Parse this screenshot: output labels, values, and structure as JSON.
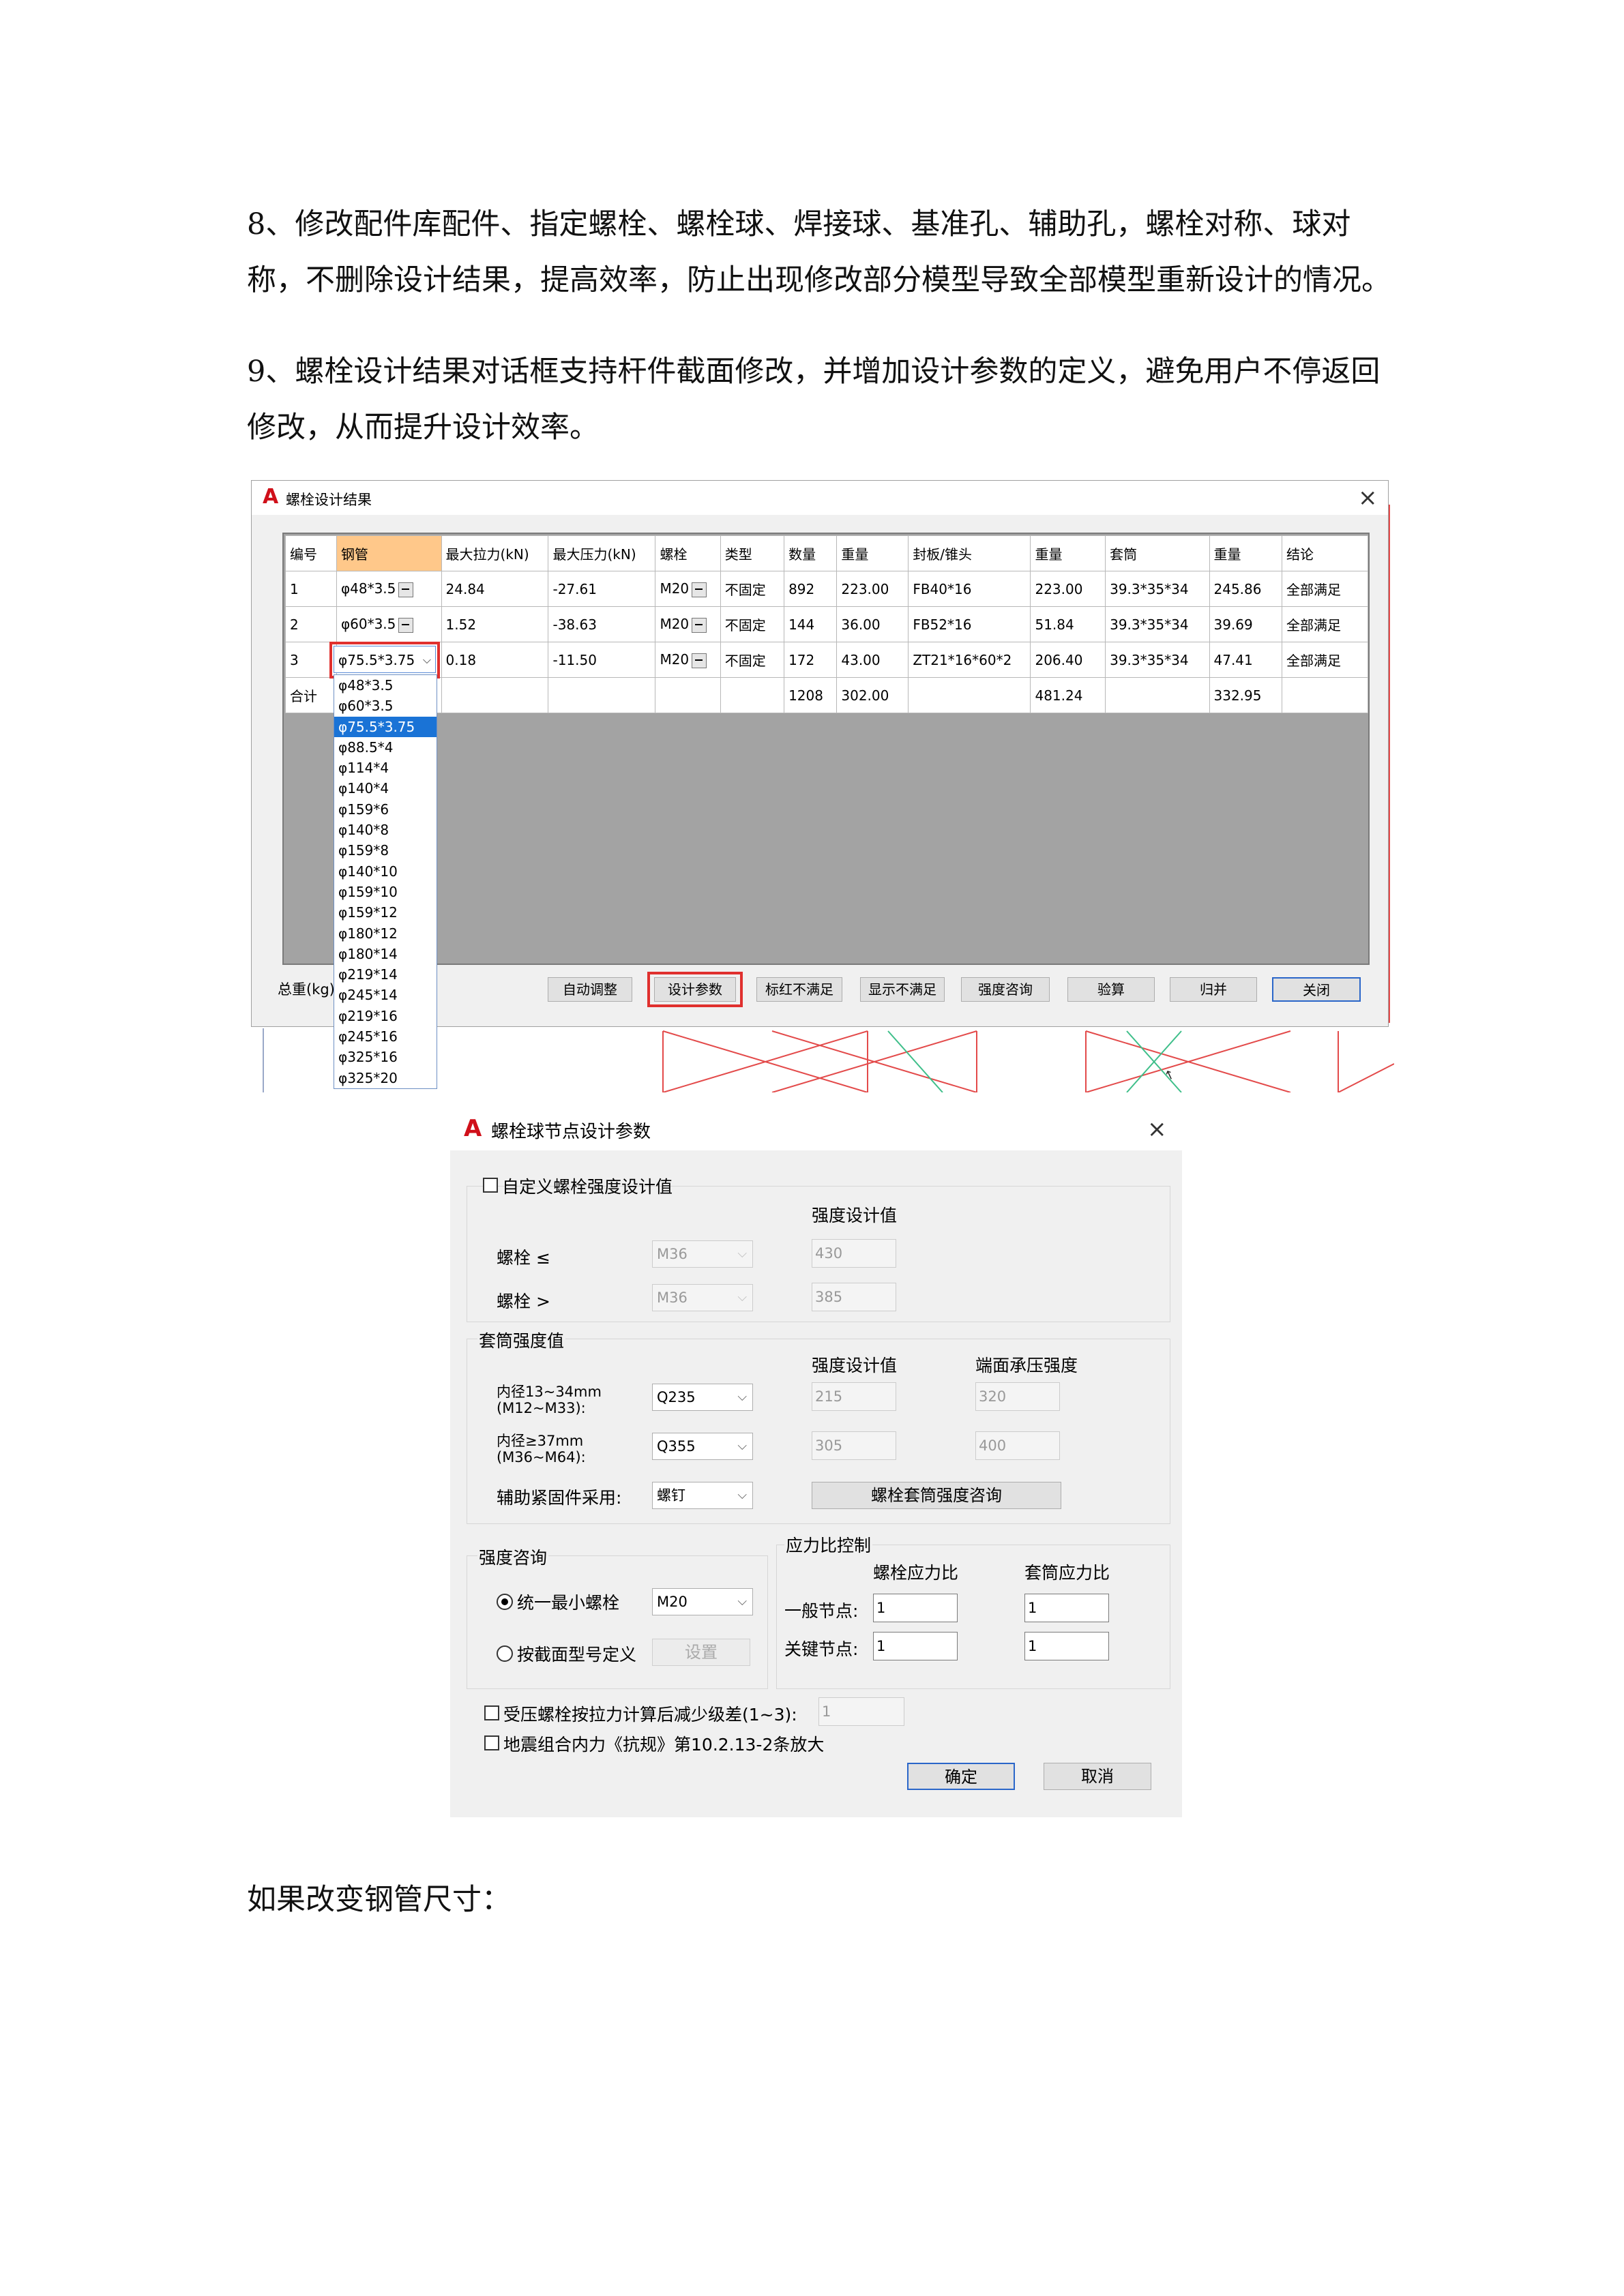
{
  "doc": {
    "para8": "8、修改配件库配件、指定螺栓、螺栓球、焊接球、基准孔、辅助孔，螺栓对称、球对称，不删除设计结果，提高效率，防止出现修改部分模型导致全部模型重新设计的情况。",
    "para9": "9、螺栓设计结果对话框支持杆件截面修改，并增加设计参数的定义，避免用户不停返回修改，从而提升设计效率。",
    "para_end": "如果改变钢管尺寸："
  },
  "dialog1": {
    "title": "螺栓设计结果",
    "columns": [
      "编号",
      "钢管",
      "最大拉力(kN)",
      "最大压力(kN)",
      "螺栓",
      "类型",
      "数量",
      "重量",
      "封板/锥头",
      "重量",
      "套筒",
      "重量",
      "结论"
    ],
    "rows": [
      [
        "1",
        "φ48*3.5",
        "24.84",
        "-27.61",
        "M20",
        "不固定",
        "892",
        "223.00",
        "FB40*16",
        "223.00",
        "39.3*35*34",
        "245.86",
        "全部满足"
      ],
      [
        "2",
        "φ60*3.5",
        "1.52",
        "-38.63",
        "M20",
        "不固定",
        "144",
        "36.00",
        "FB52*16",
        "51.84",
        "39.3*35*34",
        "39.69",
        "全部满足"
      ],
      [
        "3",
        "",
        "0.18",
        "-11.50",
        "M20",
        "不固定",
        "172",
        "43.00",
        "ZT21*16*60*2",
        "206.40",
        "39.3*35*34",
        "47.41",
        "全部满足"
      ],
      [
        "合计",
        "",
        "",
        "",
        "",
        "",
        "1208",
        "302.00",
        "",
        "481.24",
        "",
        "332.95",
        ""
      ]
    ],
    "dropdown_value": "φ75.5*3.75",
    "dropdown_options": [
      "φ48*3.5",
      "φ60*3.5",
      "φ75.5*3.75",
      "φ88.5*4",
      "φ114*4",
      "φ140*4",
      "φ159*6",
      "φ140*8",
      "φ159*8",
      "φ140*10",
      "φ159*10",
      "φ159*12",
      "φ180*12",
      "φ180*14",
      "φ219*14",
      "φ245*14",
      "φ219*16",
      "φ245*16",
      "φ325*16",
      "φ325*20"
    ],
    "total_weight_label": "总重(kg)",
    "buttons": [
      "自动调整",
      "设计参数",
      "标红不满足",
      "显示不满足",
      "强度咨询",
      "验算",
      "归并",
      "关闭"
    ],
    "colors": {
      "selected_header": "#ffc88a",
      "highlight": "#e0302e",
      "selection": "#1a73d6"
    }
  },
  "dialog2": {
    "title": "螺栓球节点设计参数",
    "custom_check": "自定义螺栓强度设计值",
    "strength_design_value": "强度设计值",
    "bolt_le": "螺栓 ≤",
    "bolt_gt": "螺栓 >",
    "bolt_le_grade": "M36",
    "bolt_gt_grade": "M36",
    "bolt_le_value": "430",
    "bolt_gt_value": "385",
    "sleeve_group": "套筒强度值",
    "sleeve_col1": "强度设计值",
    "sleeve_col2": "端面承压强度",
    "inner1_line1": "内径13~34mm",
    "inner1_line2": "(M12~M33):",
    "inner1_grade": "Q235",
    "inner1_v1": "215",
    "inner1_v2": "320",
    "inner2_line1": "内径≥37mm",
    "inner2_line2": "(M36~M64):",
    "inner2_grade": "Q355",
    "inner2_v1": "305",
    "inner2_v2": "400",
    "fastener_label": "辅助紧固件采用:",
    "fastener_value": "螺钉",
    "sleeve_consult_btn": "螺栓套筒强度咨询",
    "consult_group": "强度咨询",
    "radio_unified": "统一最小螺栓",
    "unified_value": "M20",
    "radio_section": "按截面型号定义",
    "set_btn": "设置",
    "ratio_group": "应力比控制",
    "bolt_ratio": "螺栓应力比",
    "sleeve_ratio": "套筒应力比",
    "normal_node": "一般节点:",
    "key_node": "关键节点:",
    "normal_bolt": "1",
    "normal_sleeve": "1",
    "key_bolt": "1",
    "key_sleeve": "1",
    "check_reduce": "受压螺栓按拉力计算后减少级差(1~3):",
    "reduce_value": "1",
    "check_seismic": "地震组合内力《抗规》第10.2.13-2条放大",
    "ok": "确定",
    "cancel": "取消"
  }
}
